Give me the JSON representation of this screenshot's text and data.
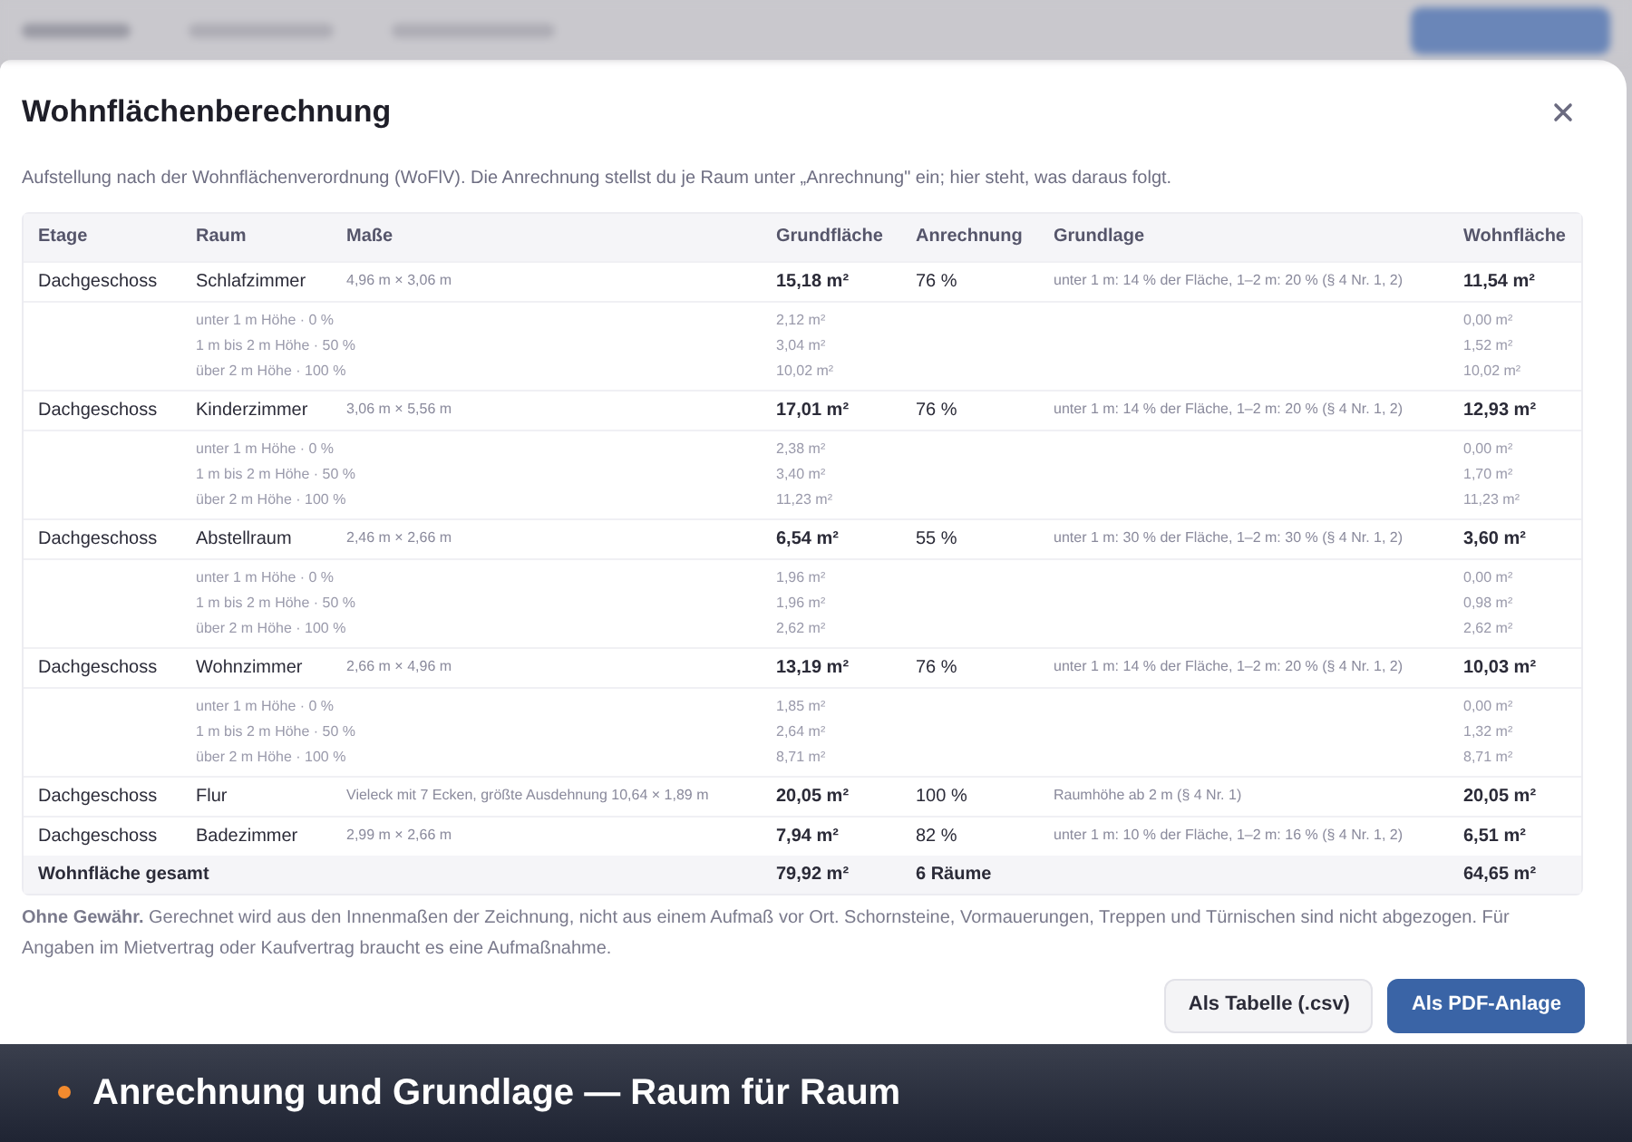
{
  "dialog": {
    "title": "Wohnflächenberechnung",
    "subtitle": "Aufstellung nach der Wohnflächenverordnung (WoFlV). Die Anrechnung stellst du je Raum unter „Anrechnung\" ein; hier steht, was daraus folgt."
  },
  "table": {
    "columns": [
      "Etage",
      "Raum",
      "Maße",
      "Grundfläche",
      "Anrechnung",
      "Grundlage",
      "Wohnfläche"
    ],
    "rows": [
      {
        "etage": "Dachgeschoss",
        "raum": "Schlafzimmer",
        "masse": "4,96 m × 3,06 m",
        "grundflaeche": "15,18 m²",
        "anrechnung": "76 %",
        "grundlage": "unter 1 m: 14 % der Fläche, 1–2 m: 20 % (§ 4 Nr. 1, 2)",
        "wohnflaeche": "11,54 m²",
        "bands": [
          {
            "label": "unter 1 m Höhe · 0 %",
            "grundflaeche": "2,12 m²",
            "wohnflaeche": "0,00 m²"
          },
          {
            "label": "1 m bis 2 m Höhe · 50 %",
            "grundflaeche": "3,04 m²",
            "wohnflaeche": "1,52 m²"
          },
          {
            "label": "über 2 m Höhe · 100 %",
            "grundflaeche": "10,02 m²",
            "wohnflaeche": "10,02 m²"
          }
        ]
      },
      {
        "etage": "Dachgeschoss",
        "raum": "Kinderzimmer",
        "masse": "3,06 m × 5,56 m",
        "grundflaeche": "17,01 m²",
        "anrechnung": "76 %",
        "grundlage": "unter 1 m: 14 % der Fläche, 1–2 m: 20 % (§ 4 Nr. 1, 2)",
        "wohnflaeche": "12,93 m²",
        "bands": [
          {
            "label": "unter 1 m Höhe · 0 %",
            "grundflaeche": "2,38 m²",
            "wohnflaeche": "0,00 m²"
          },
          {
            "label": "1 m bis 2 m Höhe · 50 %",
            "grundflaeche": "3,40 m²",
            "wohnflaeche": "1,70 m²"
          },
          {
            "label": "über 2 m Höhe · 100 %",
            "grundflaeche": "11,23 m²",
            "wohnflaeche": "11,23 m²"
          }
        ]
      },
      {
        "etage": "Dachgeschoss",
        "raum": "Abstellraum",
        "masse": "2,46 m × 2,66 m",
        "grundflaeche": "6,54 m²",
        "anrechnung": "55 %",
        "grundlage": "unter 1 m: 30 % der Fläche, 1–2 m: 30 % (§ 4 Nr. 1, 2)",
        "wohnflaeche": "3,60 m²",
        "bands": [
          {
            "label": "unter 1 m Höhe · 0 %",
            "grundflaeche": "1,96 m²",
            "wohnflaeche": "0,00 m²"
          },
          {
            "label": "1 m bis 2 m Höhe · 50 %",
            "grundflaeche": "1,96 m²",
            "wohnflaeche": "0,98 m²"
          },
          {
            "label": "über 2 m Höhe · 100 %",
            "grundflaeche": "2,62 m²",
            "wohnflaeche": "2,62 m²"
          }
        ]
      },
      {
        "etage": "Dachgeschoss",
        "raum": "Wohnzimmer",
        "masse": "2,66 m × 4,96 m",
        "grundflaeche": "13,19 m²",
        "anrechnung": "76 %",
        "grundlage": "unter 1 m: 14 % der Fläche, 1–2 m: 20 % (§ 4 Nr. 1, 2)",
        "wohnflaeche": "10,03 m²",
        "bands": [
          {
            "label": "unter 1 m Höhe · 0 %",
            "grundflaeche": "1,85 m²",
            "wohnflaeche": "0,00 m²"
          },
          {
            "label": "1 m bis 2 m Höhe · 50 %",
            "grundflaeche": "2,64 m²",
            "wohnflaeche": "1,32 m²"
          },
          {
            "label": "über 2 m Höhe · 100 %",
            "grundflaeche": "8,71 m²",
            "wohnflaeche": "8,71 m²"
          }
        ]
      },
      {
        "etage": "Dachgeschoss",
        "raum": "Flur",
        "masse": "Vieleck mit 7 Ecken, größte Ausdehnung 10,64 × 1,89 m",
        "grundflaeche": "20,05 m²",
        "anrechnung": "100 %",
        "grundlage": "Raumhöhe ab 2 m (§ 4 Nr. 1)",
        "wohnflaeche": "20,05 m²"
      },
      {
        "etage": "Dachgeschoss",
        "raum": "Badezimmer",
        "masse": "2,99 m × 2,66 m",
        "grundflaeche": "7,94 m²",
        "anrechnung": "82 %",
        "grundlage": "unter 1 m: 10 % der Fläche, 1–2 m: 16 % (§ 4 Nr. 1, 2)",
        "wohnflaeche": "6,51 m²"
      }
    ],
    "total": {
      "label": "Wohnfläche gesamt",
      "grundflaeche": "79,92 m²",
      "anrechnung": "6 Räume",
      "wohnflaeche": "64,65 m²"
    }
  },
  "note": "**Ohne Gewähr.** Gerechnet wird aus den Innenmaßen der Zeichnung, nicht aus einem Aufmaß vor Ort. Schornsteine, Vormauerungen, Treppen und Türnischen sind nicht abgezogen. Für Angaben im Mietvertrag oder Kaufvertrag braucht es eine Aufmaßnahme.",
  "buttons": [
    {
      "label": "Als Tabelle (.csv)",
      "kind": "secondary"
    },
    {
      "label": "Als PDF-Anlage",
      "kind": "primary"
    }
  ],
  "caption": "Anrechnung und Grundlage — Raum für Raum"
}
